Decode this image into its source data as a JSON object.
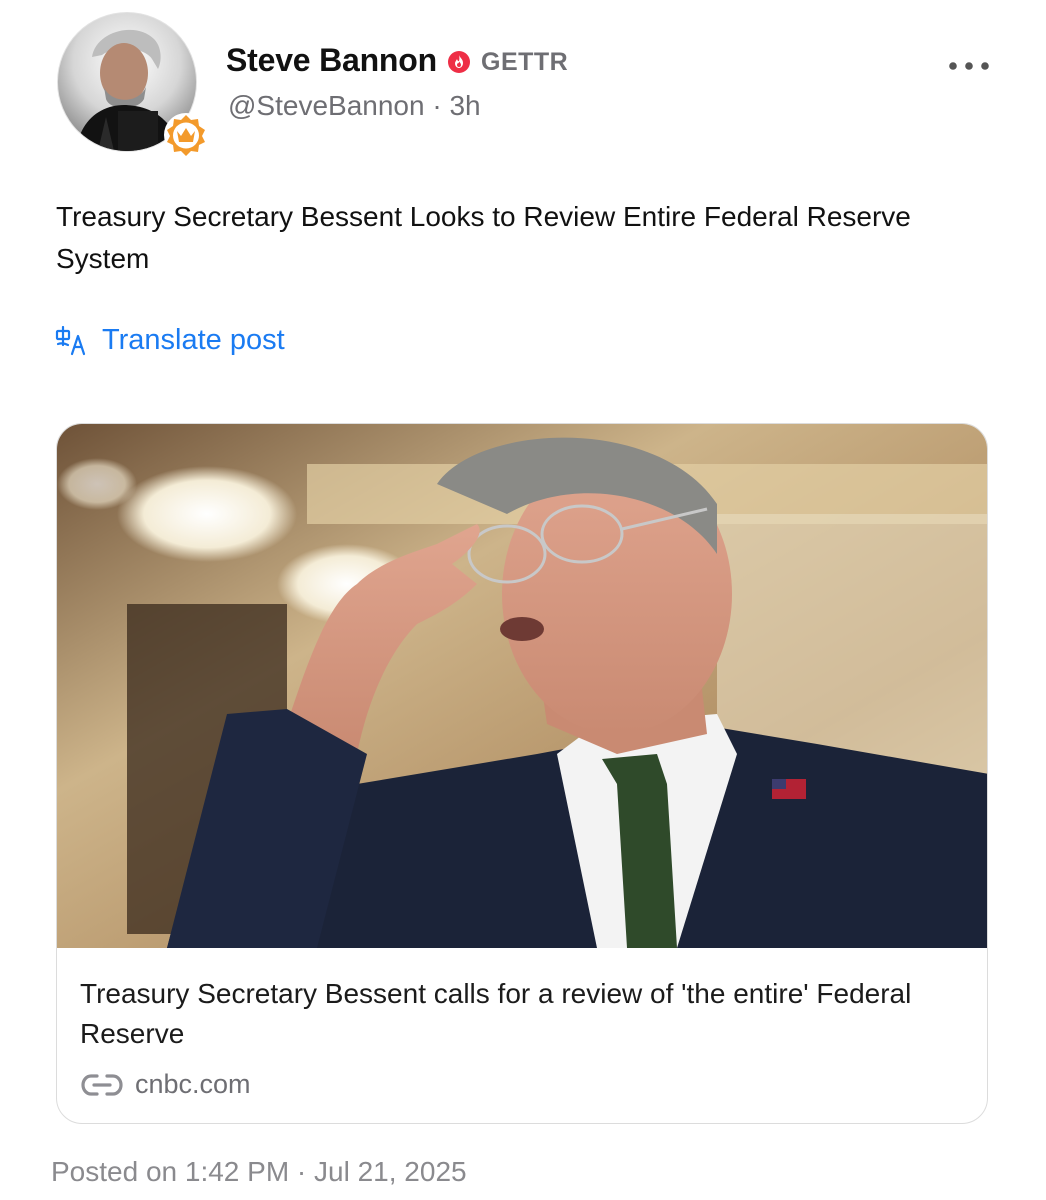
{
  "post": {
    "author_name": "Steve Bannon",
    "platform": "GETTR",
    "handle": "@SteveBannon",
    "separator": "·",
    "age": "3h",
    "text": "Treasury Secretary Bessent Looks to Review Entire Federal Reserve System",
    "translate_label": "Translate post",
    "more_icon": "more-horizontal-icon",
    "posted_at": "Posted on 1:42 PM · Jul 21, 2025"
  },
  "link_card": {
    "title": "Treasury Secretary Bessent calls for a review of 'the entire' Federal Reserve",
    "domain": "cnbc.com",
    "icon": "link-icon"
  },
  "colors": {
    "link_blue": "#1a7bf2",
    "verified_red": "#ee2e46",
    "crown_orange": "#f39a2b",
    "muted_gray": "#6e6e73"
  }
}
